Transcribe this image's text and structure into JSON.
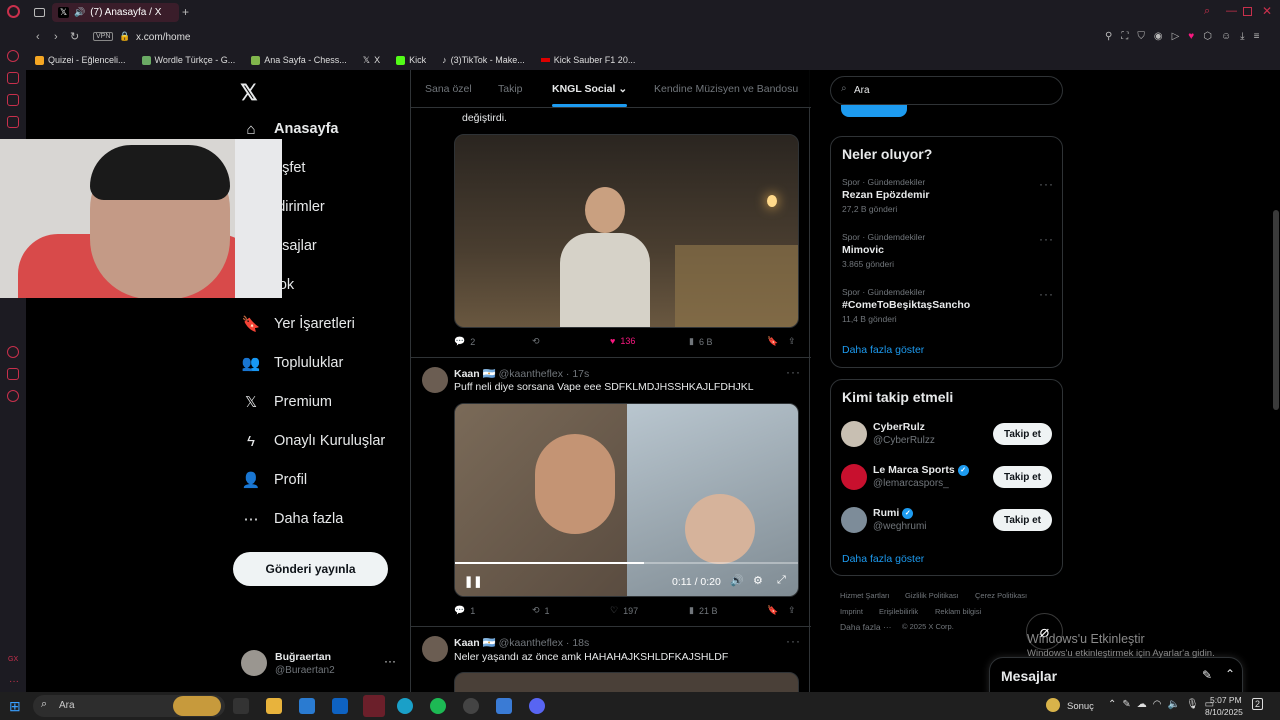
{
  "browser": {
    "tab_title": "(7) Anasayfa / X",
    "url": "x.com/home",
    "vpn": "VPN",
    "bookmarks": [
      "Quizei - Eğlenceli...",
      "Wordle Türkçe - G...",
      "Ana Sayfa - Chess...",
      "X",
      "Kick",
      "(3)TikTok - Make...",
      "Kick Sauber F1 20..."
    ]
  },
  "nav": {
    "items": [
      {
        "label": "Anasayfa",
        "icon": "home-icon"
      },
      {
        "label": "Keşfet",
        "icon": "search-icon"
      },
      {
        "label": "Bildirimler",
        "icon": "bell-icon"
      },
      {
        "label": "Mesajlar",
        "icon": "mail-icon"
      },
      {
        "label": "Grok",
        "icon": "grok-icon"
      },
      {
        "label": "Yer İşaretleri",
        "icon": "bookmark-icon"
      },
      {
        "label": "Topluluklar",
        "icon": "communities-icon"
      },
      {
        "label": "Premium",
        "icon": "x-logo-icon"
      },
      {
        "label": "Onaylı Kuruluşlar",
        "icon": "lightning-icon"
      },
      {
        "label": "Profil",
        "icon": "person-icon"
      },
      {
        "label": "Daha fazla",
        "icon": "more-circle-icon"
      }
    ],
    "visible": {
      "home": "Anasayfa",
      "explore": "eşfet",
      "notifications": "ldirimler",
      "messages": "esajlar",
      "grok": "rok",
      "bookmarks": "Yer İşaretleri",
      "communities": "Topluluklar",
      "premium": "Premium",
      "verified_orgs": "Onaylı Kuruluşlar",
      "profile": "Profil",
      "more": "Daha fazla"
    },
    "post_button": "Gönderi yayınla",
    "account": {
      "name": "Buğraertan",
      "handle": "@Buraertan2"
    }
  },
  "feed": {
    "tabs": [
      "Sana özel",
      "Takip",
      "KNGL Social",
      "Kendine Müzisyen ve Bandosu"
    ],
    "tweet1": {
      "text_tail": "değiştirdi.",
      "replies": "2",
      "likes": "136",
      "views": "6 B"
    },
    "tweet2": {
      "name": "Kaan",
      "handle": "@kaantheflex",
      "time": "17s",
      "text": "Puff neli diye sorsana Vape eee SDFKLMDJHSSHKAJLFDHJKL",
      "video_time": "0:11 / 0:20",
      "video_progress": 0.55,
      "replies": "1",
      "retweets": "1",
      "likes": "197",
      "views": "21 B"
    },
    "tweet3": {
      "name": "Kaan",
      "handle": "@kaantheflex",
      "time": "18s",
      "text": "Neler yaşandı az önce amk HAHAHAJKSHLDFKAJSHLDF"
    }
  },
  "right": {
    "search_value": "Ara",
    "trends_title": "Neler oluyor?",
    "trends": [
      {
        "category": "Spor · Gündemdekiler",
        "name": "Rezan Epözdemir",
        "count": "27,2 B gönderi"
      },
      {
        "category": "Spor · Gündemdekiler",
        "name": "Mimovic",
        "count": "3.865 gönderi"
      },
      {
        "category": "Spor · Gündemdekiler",
        "name": "#ComeToBeşiktaşSancho",
        "count": "11,4 B gönderi"
      }
    ],
    "show_more": "Daha fazla göster",
    "who_title": "Kimi takip etmeli",
    "who": [
      {
        "name": "CyberRulz",
        "handle": "@CyberRulzz",
        "verified": false
      },
      {
        "name": "Le Marca Sports",
        "handle": "@lemarcaspors_",
        "verified": true
      },
      {
        "name": "Rumi",
        "handle": "@weghrumi",
        "verified": true
      }
    ],
    "follow_label": "Takip et",
    "footer": [
      "Hizmet Şartları",
      "Gizlilik Politikası",
      "Çerez Politikası",
      "Imprint",
      "Erişilebilirlik",
      "Reklam bilgisi",
      "Daha fazla ···",
      "© 2025 X Corp."
    ],
    "messages_label": "Mesajlar"
  },
  "windows": {
    "activate_title": "Windows'u Etkinleştir",
    "activate_sub": "Windows'u etkinleştirmek için Ayarlar'a gidin.",
    "search": "Ara",
    "weather": "Sonuç",
    "time": "5:07 PM",
    "date": "8/10/2025",
    "notif_count": "2"
  },
  "colors": {
    "accent": "#1d9bf0",
    "like": "#f91880",
    "opera": "#c8304c"
  }
}
